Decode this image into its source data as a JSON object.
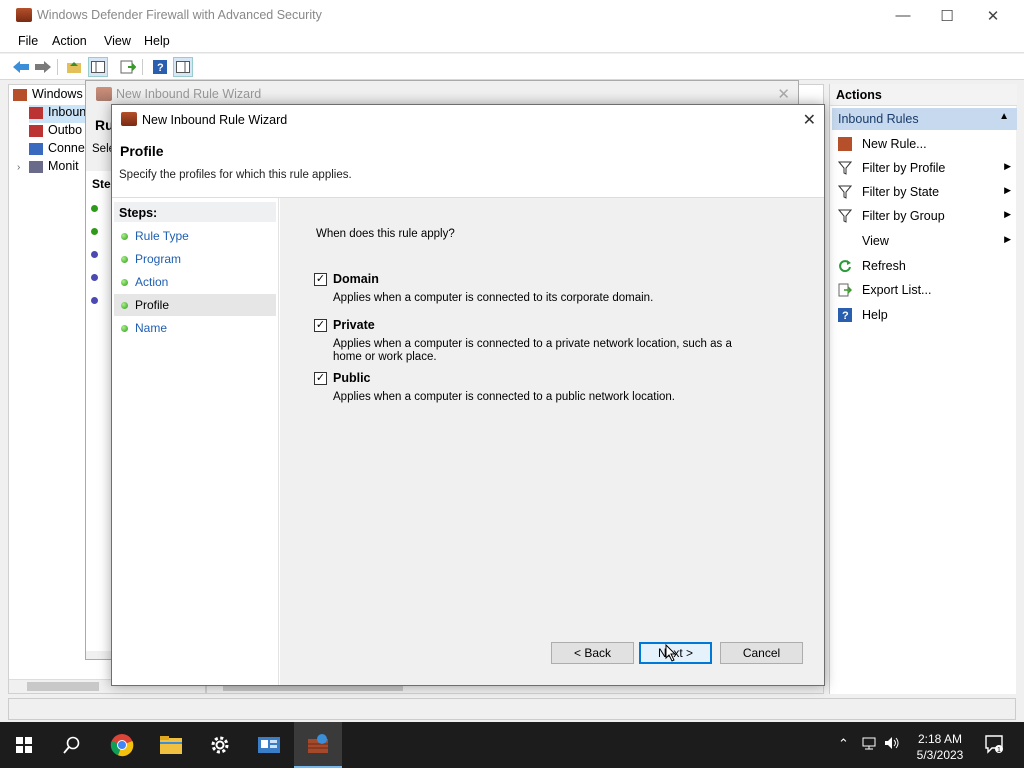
{
  "window": {
    "title": "Windows Defender Firewall with Advanced Security",
    "minimize": "—",
    "maximize": "☐",
    "close": "✕"
  },
  "menu": {
    "file": "File",
    "action": "Action",
    "view": "View",
    "help": "Help"
  },
  "tree": {
    "root": "Windows",
    "items": [
      "Inboun",
      "Outbo",
      "Conne",
      "Monit"
    ]
  },
  "bg_wizard": {
    "title": "New Inbound Rule Wizard",
    "heading_partial": "Ru",
    "desc_partial": "Sele",
    "steps_partial": "Step"
  },
  "actions": {
    "header": "Actions",
    "group": "Inbound Rules",
    "items": [
      {
        "label": "New Rule...",
        "icon": "new-rule-icon",
        "submenu": false
      },
      {
        "label": "Filter by Profile",
        "icon": "filter-icon",
        "submenu": true
      },
      {
        "label": "Filter by State",
        "icon": "filter-icon",
        "submenu": true
      },
      {
        "label": "Filter by Group",
        "icon": "filter-icon",
        "submenu": true
      },
      {
        "label": "View",
        "icon": "",
        "submenu": true
      },
      {
        "label": "Refresh",
        "icon": "refresh-icon",
        "submenu": false
      },
      {
        "label": "Export List...",
        "icon": "export-icon",
        "submenu": false
      },
      {
        "label": "Help",
        "icon": "help-icon",
        "submenu": false
      }
    ]
  },
  "wizard": {
    "title": "New Inbound Rule Wizard",
    "close": "✕",
    "heading": "Profile",
    "description": "Specify the profiles for which this rule applies.",
    "steps_title": "Steps:",
    "steps": [
      "Rule Type",
      "Program",
      "Action",
      "Profile",
      "Name"
    ],
    "active_step": "Profile",
    "question": "When does this rule apply?",
    "options": [
      {
        "label": "Domain",
        "checked": true,
        "description": "Applies when a computer is connected to its corporate domain."
      },
      {
        "label": "Private",
        "checked": true,
        "description": "Applies when a computer is connected to a private network location, such as a home or work place."
      },
      {
        "label": "Public",
        "checked": true,
        "description": "Applies when a computer is connected to a public network location."
      }
    ],
    "buttons": {
      "back": "< Back",
      "next": "Next >",
      "cancel": "Cancel"
    }
  },
  "taskbar": {
    "time": "2:18 AM",
    "date": "5/3/2023"
  }
}
